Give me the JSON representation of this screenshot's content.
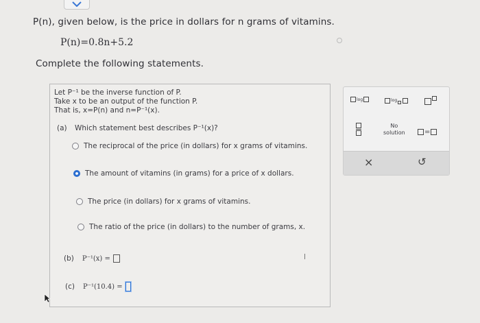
{
  "question": {
    "intro": "P(n), given below, is the price in dollars for n grams of vitamins.",
    "formula": "P(n)=0.8n+5.2",
    "instruction": "Complete the following statements."
  },
  "panel": {
    "line1": "Let P⁻¹ be the inverse function of P.",
    "line2": "Take x to be an output of the function P.",
    "line3": "That is, x=P(n) and n=P⁻¹(x).",
    "part_a": {
      "label": "(a)",
      "prompt": "Which statement best describes P⁻¹(x)?",
      "options": [
        {
          "text": "The reciprocal of the price (in dollars) for x grams of vitamins.",
          "selected": false
        },
        {
          "text": "The amount of vitamins (in grams) for a price of x dollars.",
          "selected": true
        },
        {
          "text": "The price (in dollars) for x grams of vitamins.",
          "selected": false
        },
        {
          "text": "The ratio of the price (in dollars) to the number of grams, x.",
          "selected": false
        }
      ]
    },
    "part_b": {
      "label": "(b)",
      "expr": "P⁻¹(x) ="
    },
    "part_c": {
      "label": "(c)",
      "expr": "P⁻¹(10.4) ="
    }
  },
  "toolbar": {
    "log_label": "log",
    "log_base_label": "log",
    "no_solution": "No\nsolution",
    "clear_symbol": "×",
    "undo_symbol": "↺"
  },
  "colors": {
    "accent": "#2c6fd0",
    "background": "#ecebe9",
    "panel_border": "#b9b9b9"
  }
}
